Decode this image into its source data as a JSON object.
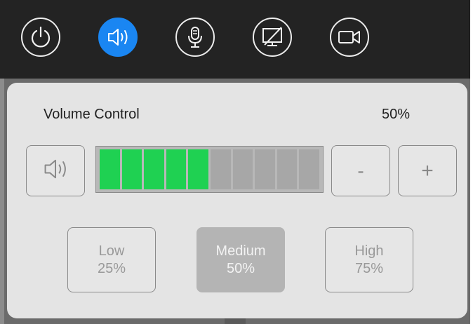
{
  "toolbar": {
    "buttons": [
      {
        "icon": "power-icon",
        "active": false
      },
      {
        "icon": "speaker-icon",
        "active": true
      },
      {
        "icon": "microphone-icon",
        "active": false
      },
      {
        "icon": "display-off-icon",
        "active": false
      },
      {
        "icon": "camera-icon",
        "active": false
      }
    ],
    "active_color": "#1a86f2"
  },
  "volume_panel": {
    "title": "Volume Control",
    "percent_label": "50%",
    "level_fraction": 0.5,
    "segments_total": 10,
    "segments_on": 5,
    "on_color": "#1fd152",
    "minus_label": "-",
    "plus_label": "+",
    "mute_icon": "speaker-icon",
    "presets": [
      {
        "name": "Low",
        "value": "25%",
        "selected": false
      },
      {
        "name": "Medium",
        "value": "50%",
        "selected": true
      },
      {
        "name": "High",
        "value": "75%",
        "selected": false
      }
    ]
  }
}
